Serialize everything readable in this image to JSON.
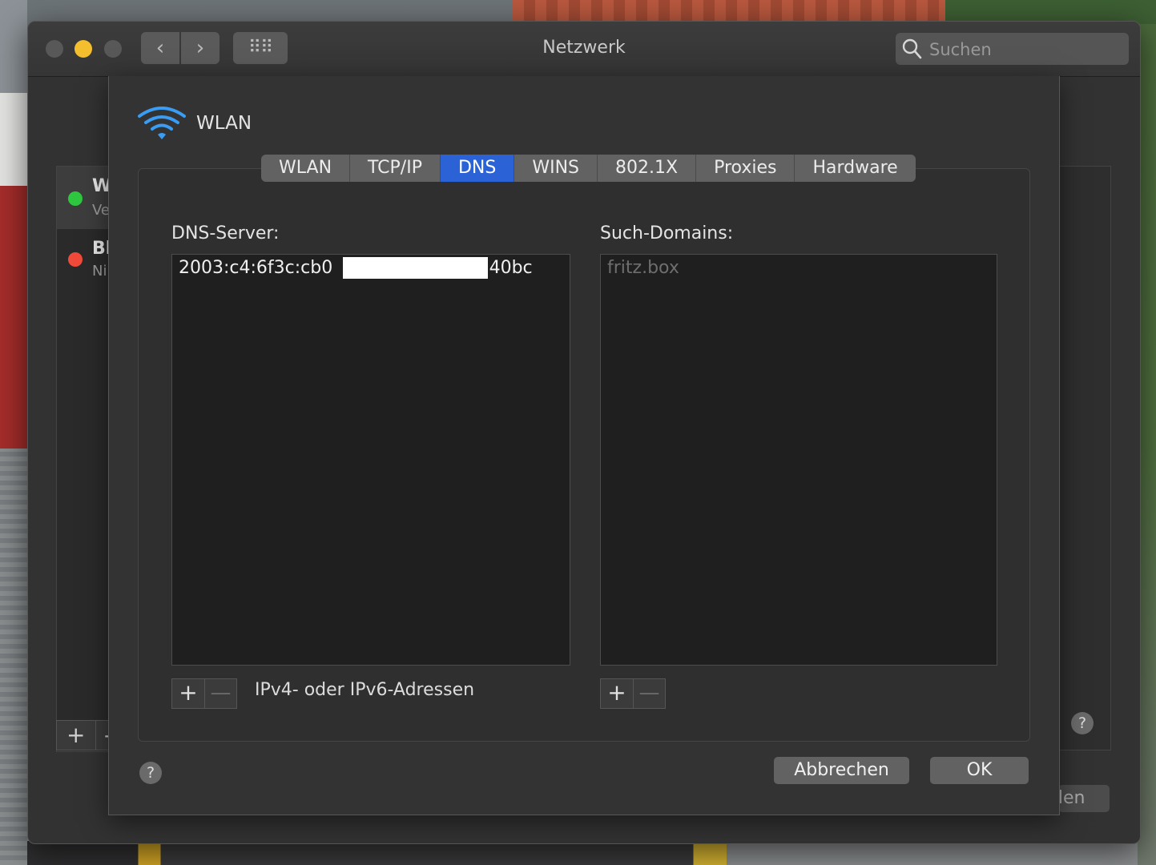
{
  "window": {
    "title": "Netzwerk",
    "search_placeholder": "Suchen",
    "nav": {
      "back": "‹",
      "forward": "›",
      "grid": "⠿⠿"
    }
  },
  "sidebar": {
    "services": [
      {
        "name": "W",
        "status": "Ve",
        "status_color": "#2fc640"
      },
      {
        "name": "Bl",
        "status": "Ni",
        "status_color": "#f04b3a"
      }
    ],
    "add": "+",
    "remove": "-"
  },
  "background": {
    "apply_label": "den",
    "help": "?"
  },
  "sheet": {
    "title": "WLAN",
    "tabs": [
      {
        "label": "WLAN",
        "active": false
      },
      {
        "label": "TCP/IP",
        "active": false
      },
      {
        "label": "DNS",
        "active": true
      },
      {
        "label": "WINS",
        "active": false
      },
      {
        "label": "802.1X",
        "active": false
      },
      {
        "label": "Proxies",
        "active": false
      },
      {
        "label": "Hardware",
        "active": false
      }
    ],
    "dns": {
      "label": "DNS-Server:",
      "entries": [
        {
          "prefix": "2003:c4:6f3c:cb0",
          "suffix": "f:40bc"
        }
      ],
      "add": "+",
      "remove": "—",
      "hint": "IPv4- oder IPv6-Adressen"
    },
    "search_domains": {
      "label": "Such-Domains:",
      "entries": [
        "fritz.box"
      ],
      "add": "+",
      "remove": "—"
    },
    "help": "?",
    "cancel": "Abbrechen",
    "ok": "OK"
  },
  "colors": {
    "accent": "#2b63d6",
    "wifi": "#3a9cf2",
    "green": "#2fc640",
    "red": "#f04b3a",
    "yellow": "#f3bf2f"
  }
}
